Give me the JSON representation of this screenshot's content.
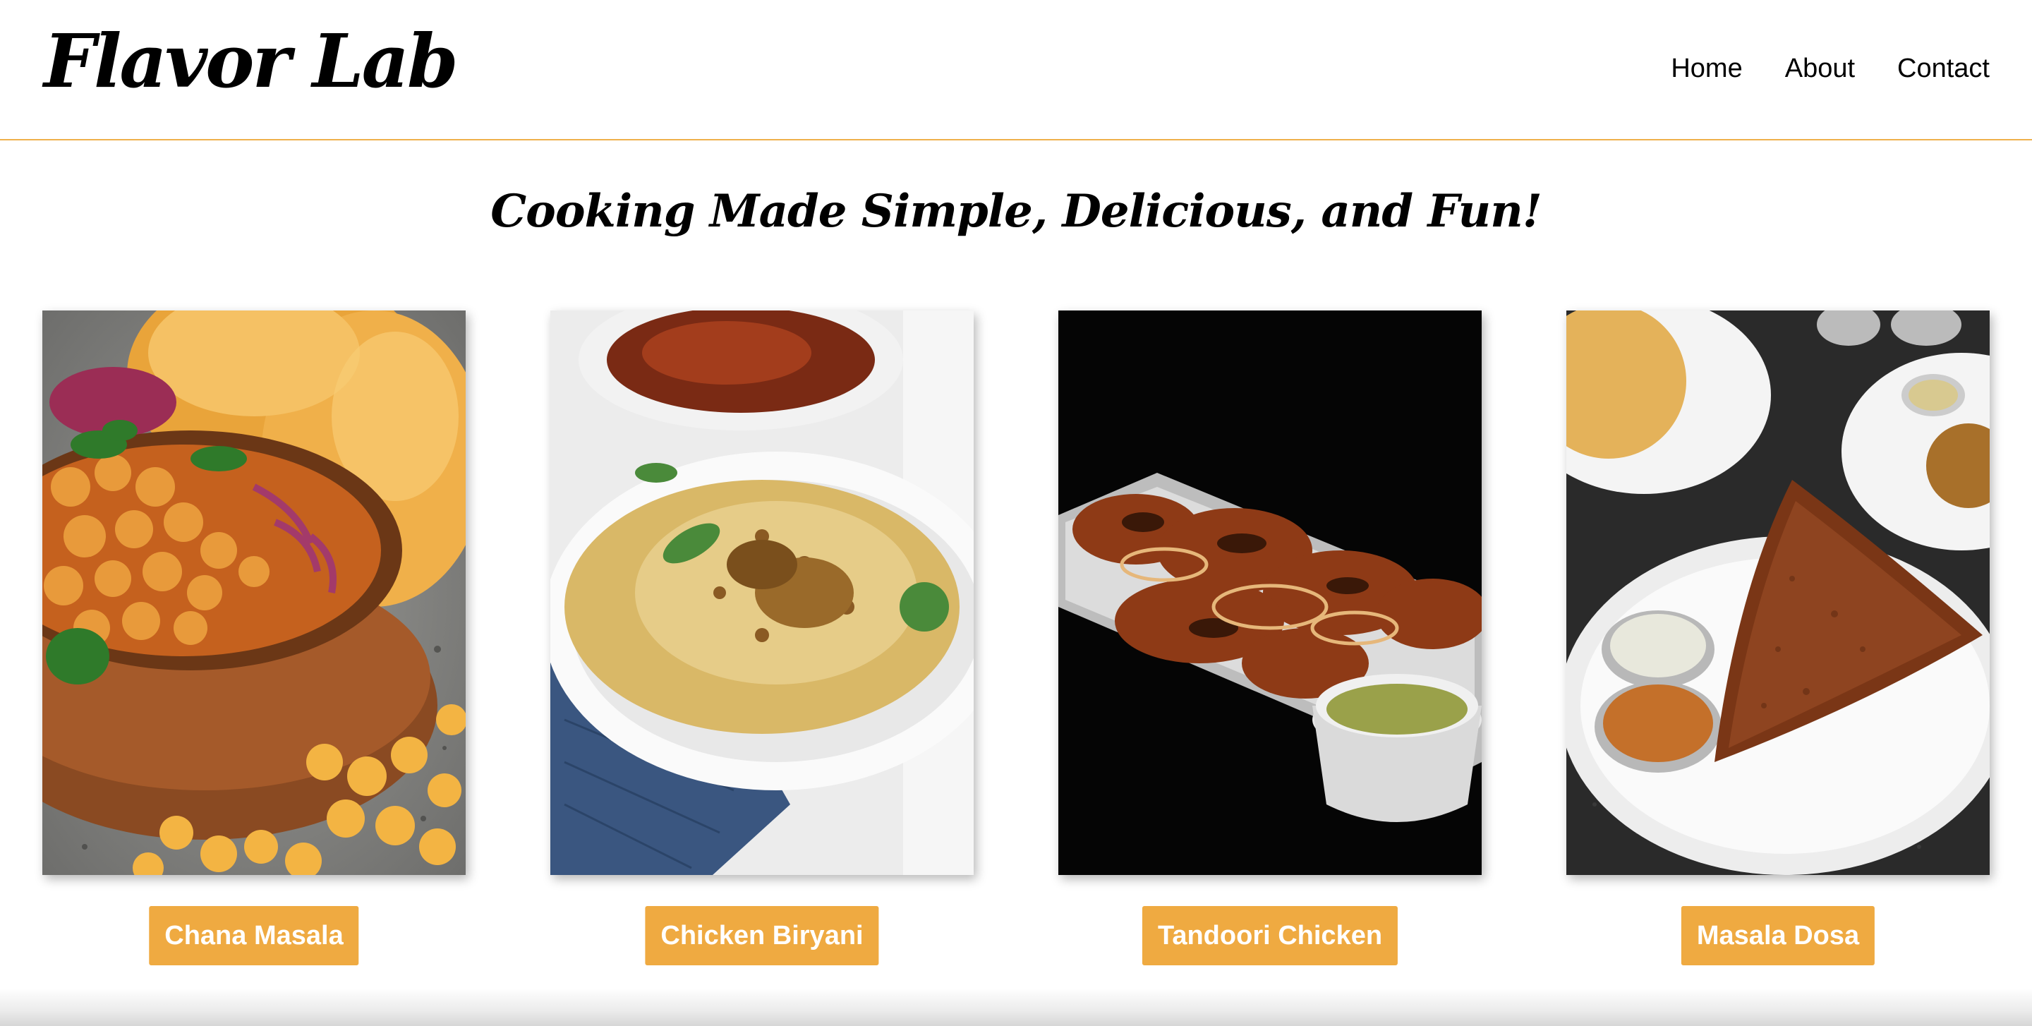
{
  "header": {
    "logo": "Flavor Lab",
    "nav": [
      {
        "label": "Home"
      },
      {
        "label": "About"
      },
      {
        "label": "Contact"
      }
    ]
  },
  "hero": {
    "tagline": "Cooking Made Simple, Delicious, and Fun!"
  },
  "recipes": [
    {
      "name": "Chana Masala"
    },
    {
      "name": "Chicken Biryani"
    },
    {
      "name": "Tandoori Chicken"
    },
    {
      "name": "Masala Dosa"
    }
  ],
  "colors": {
    "accent": "#efaa41",
    "header_border": "#efb04b",
    "text": "#000000",
    "button_text": "#ffffff"
  }
}
